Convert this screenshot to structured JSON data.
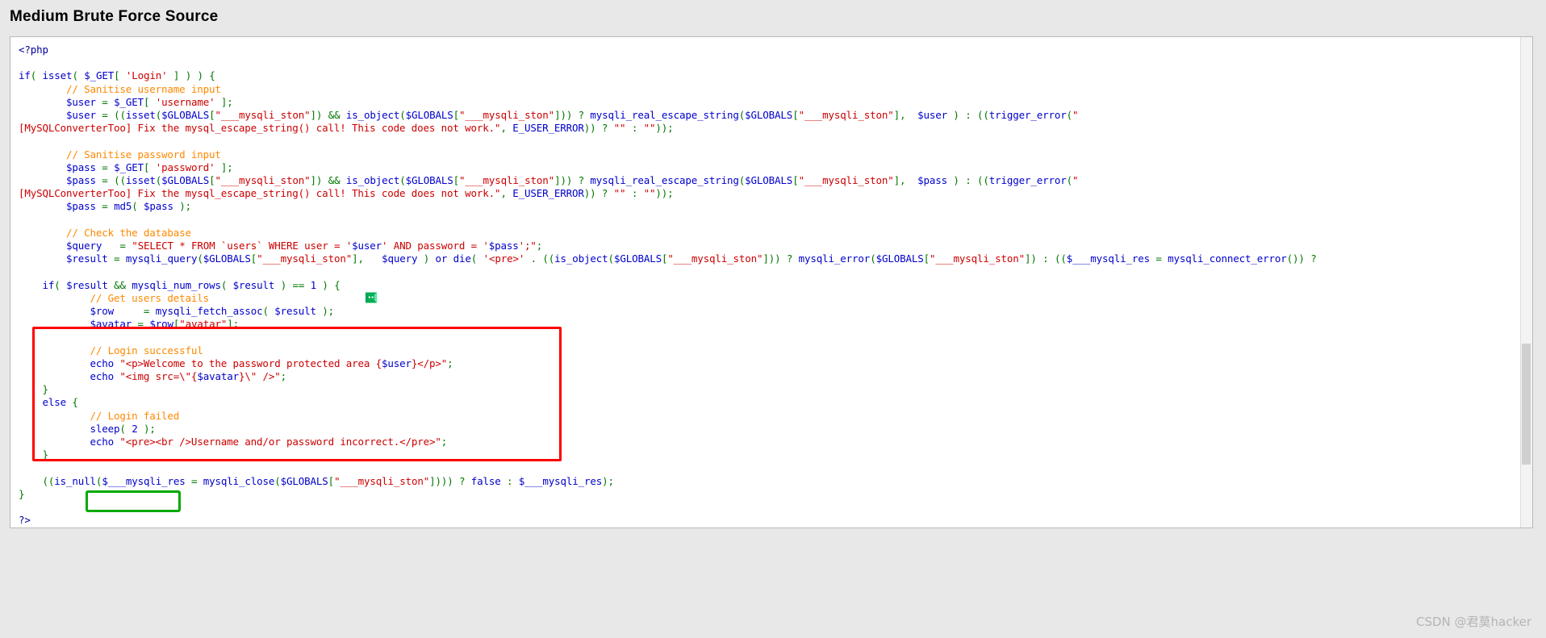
{
  "page": {
    "title": "Medium Brute Force Source"
  },
  "watermark": {
    "text": "CSDN @君莫hacker"
  },
  "icons": {
    "message_icon": "green-message-bubble-icon",
    "scrollbar": "vertical-scrollbar"
  },
  "annotations": {
    "red_box": {
      "color": "#ff0000",
      "label": "red-highlight-rectangle",
      "targets": "if( $result && mysqli_num_rows( $result ) == 1 ) { ... }"
    },
    "green_box": {
      "color": "#00aa00",
      "label": "green-highlight-rectangle",
      "targets": "sleep( 2 );"
    }
  },
  "syntax_colors": {
    "keyword": "#0000cc",
    "variable": "#0000cc",
    "string": "#cc0000",
    "comment": "#ff8800",
    "punctuation": "#007700",
    "php_tag": "#000099"
  },
  "code": {
    "language": "php",
    "lines": [
      "<?php",
      "",
      "if( isset( $_GET[ 'Login' ] ) ) {",
      "        // Sanitise username input",
      "        $user = $_GET[ 'username' ];",
      "        $user = ((isset($GLOBALS[\"___mysqli_ston\"]) && is_object($GLOBALS[\"___mysqli_ston\"])) ? mysqli_real_escape_string($GLOBALS[\"___mysqli_ston\"],  $user ) : ((trigger_error(\"[MySQLConverterToo] Fix the mysql_escape_string() call! This code does not work.\", E_USER_ERROR)) ? \"\" : \"\"));",
      "",
      "        // Sanitise password input",
      "        $pass = $_GET[ 'password' ];",
      "        $pass = ((isset($GLOBALS[\"___mysqli_ston\"]) && is_object($GLOBALS[\"___mysqli_ston\"])) ? mysqli_real_escape_string($GLOBALS[\"___mysqli_ston\"],  $pass ) : ((trigger_error(\"[MySQLConverterToo] Fix the mysql_escape_string() call! This code does not work.\", E_USER_ERROR)) ? \"\" : \"\"));",
      "        $pass = md5( $pass );",
      "",
      "        // Check the database",
      "        $query  = \"SELECT * FROM `users` WHERE user = '$user' AND password = '$pass';\";",
      "        $result = mysqli_query($GLOBALS[\"___mysqli_ston\"],  $query ) or die( '<pre>' . ((is_object($GLOBALS[\"___mysqli_ston\"])) ? mysqli_error($GLOBALS[\"___mysqli_ston\"]) : (($___mysqli_res = mysqli_connect_error()) ?",
      "",
      "        if( $result && mysqli_num_rows( $result ) == 1 ) {",
      "                // Get users details",
      "                $row    = mysqli_fetch_assoc( $result );",
      "                $avatar = $row[\"avatar\"];",
      "",
      "                // Login successful",
      "                echo \"<p>Welcome to the password protected area {$user}</p>\";",
      "                echo \"<img src=\\\"{$avatar}\\\" />\";",
      "        }",
      "        else {",
      "                // Login failed",
      "                sleep( 2 );",
      "                echo \"<pre><br />Username and/or password incorrect.</pre>\";",
      "        }",
      "",
      "        ((is_null($___mysqli_res = mysqli_close($GLOBALS[\"___mysqli_ston\"]))) ? false : $___mysqli_res);",
      "}",
      "",
      "?>"
    ]
  }
}
